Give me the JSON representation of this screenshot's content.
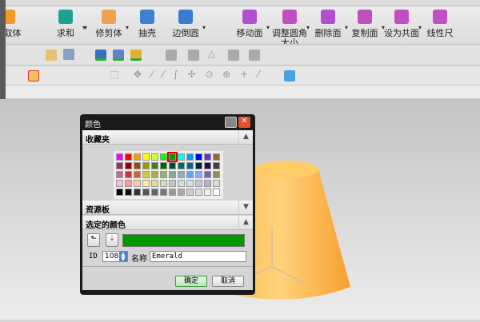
{
  "toolbar": {
    "big_buttons": [
      {
        "label": "抽取体",
        "short": "取体",
        "color": "#f39b2a"
      },
      {
        "label": "求和",
        "color": "#1fa090"
      },
      {
        "label": "修剪体",
        "color": "#f0a050"
      },
      {
        "label": "抽壳",
        "color": "#4080d0"
      },
      {
        "label": "边倒圆",
        "color": "#3a7ad0"
      },
      {
        "label": "移动面",
        "color": "#b050d0"
      },
      {
        "label": "调整圆角大小",
        "line1": "调整圆角",
        "line2": "大小",
        "color": "#c050c0"
      },
      {
        "label": "删除面",
        "color": "#b050d0"
      },
      {
        "label": "复制面",
        "color": "#c050c0"
      },
      {
        "label": "设为共面",
        "color": "#c050c0"
      },
      {
        "label": "线性尺",
        "color": "#c050c0"
      }
    ]
  },
  "dialog": {
    "title": "颜色",
    "favorites_label": "收藏夹",
    "palette_label": "资源板",
    "selected_label": "选定的颜色",
    "swatches": [
      [
        "#ff00ff",
        "#ff0000",
        "#ff9900",
        "#ffff00",
        "#ccff33",
        "#00ff00",
        "#009900",
        "#00ffff",
        "#0099ff",
        "#0000ff",
        "#6633cc",
        "#996633"
      ],
      [
        "#993366",
        "#990000",
        "#994c00",
        "#999900",
        "#4c7a1a",
        "#006600",
        "#004d33",
        "#006666",
        "#006699",
        "#002244",
        "#330066",
        "#4c3d33"
      ],
      [
        "#cc6699",
        "#cc3333",
        "#cc6633",
        "#cccc33",
        "#aaaa55",
        "#88bb66",
        "#88aa99",
        "#88b0c0",
        "#55aaff",
        "#88aaff",
        "#7766aa",
        "#998866"
      ],
      [
        "#ffbbdd",
        "#ff9999",
        "#ffcc99",
        "#ffee99",
        "#dddd99",
        "#cce0bb",
        "#bbccbb",
        "#cce0dd",
        "#cce0ee",
        "#bbccdd",
        "#bbaadd",
        "#ddddcc"
      ],
      [
        "#000000",
        "#111111",
        "#333333",
        "#555555",
        "#666666",
        "#777777",
        "#999999",
        "#aaaaaa",
        "#cccccc",
        "#dddddd",
        "#eeeeee",
        "#ffffff"
      ]
    ],
    "selected_color": "#009900",
    "id_label": "ID",
    "id_value": "108",
    "name_label": "名称",
    "name_value": "Emerald",
    "ok_label": "确定",
    "cancel_label": "取消"
  }
}
